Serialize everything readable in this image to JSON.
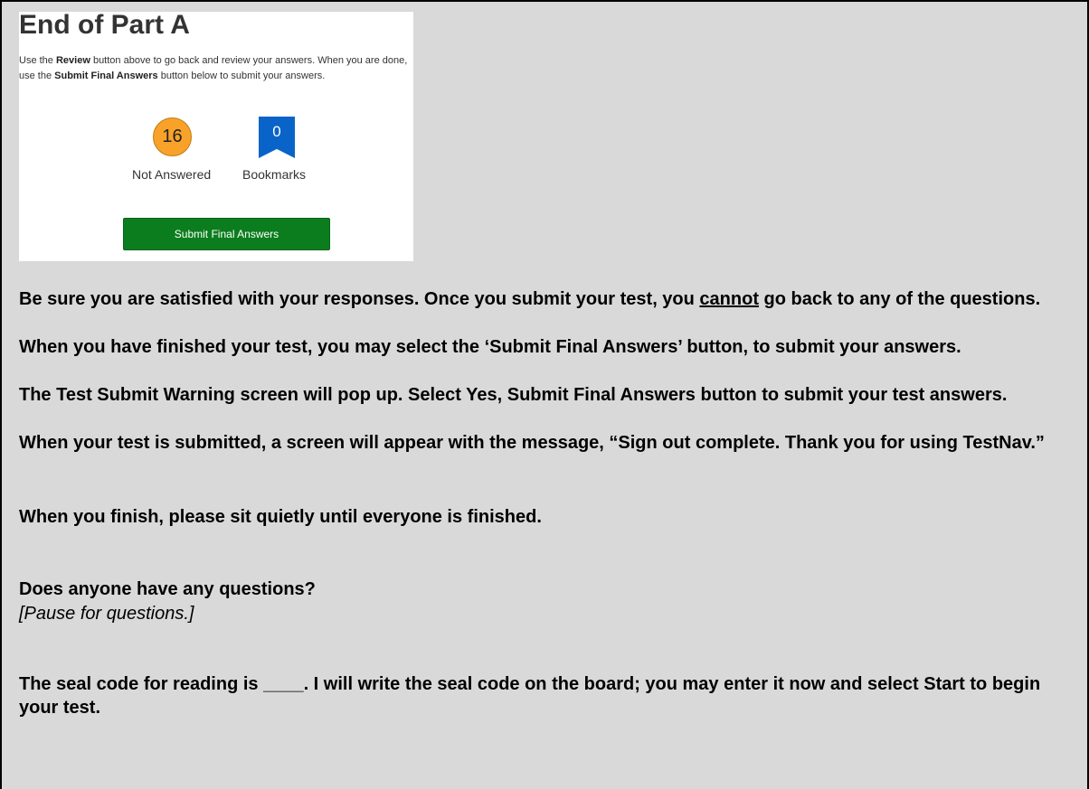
{
  "screenshot": {
    "title": "End of Part A",
    "instructions": {
      "part1": "Use the ",
      "review": "Review",
      "part2": " button above to go back and review your answers. When you are done, use the ",
      "submit": "Submit Final Answers",
      "part3": " button below to submit your answers."
    },
    "not_answered": {
      "count": "16",
      "label": "Not Answered"
    },
    "bookmarks": {
      "count": "0",
      "label": "Bookmarks"
    },
    "submit_button": "Submit Final Answers"
  },
  "script": {
    "p1_before": "Be sure you are satisfied with your responses. Once you submit your test, you ",
    "p1_underline": "cannot",
    "p1_after": " go back to any of the questions.",
    "p2": "When you have finished your test, you may select the ‘Submit Final Answers’ button, to submit your answers.",
    "p3": "The Test Submit Warning screen will pop up. Select Yes, Submit Final Answers button to submit your test answers.",
    "p4": "When your test is submitted, a screen will appear with the message, “Sign out complete. Thank you for using TestNav.”",
    "p5": "When you finish, please sit quietly until everyone is finished.",
    "p6": "Does anyone have any questions?",
    "p6_pause": "[Pause for questions.]",
    "p7": "The seal code for reading is ____. I will write the seal code on the board; you may enter it now and select Start to begin your test."
  }
}
